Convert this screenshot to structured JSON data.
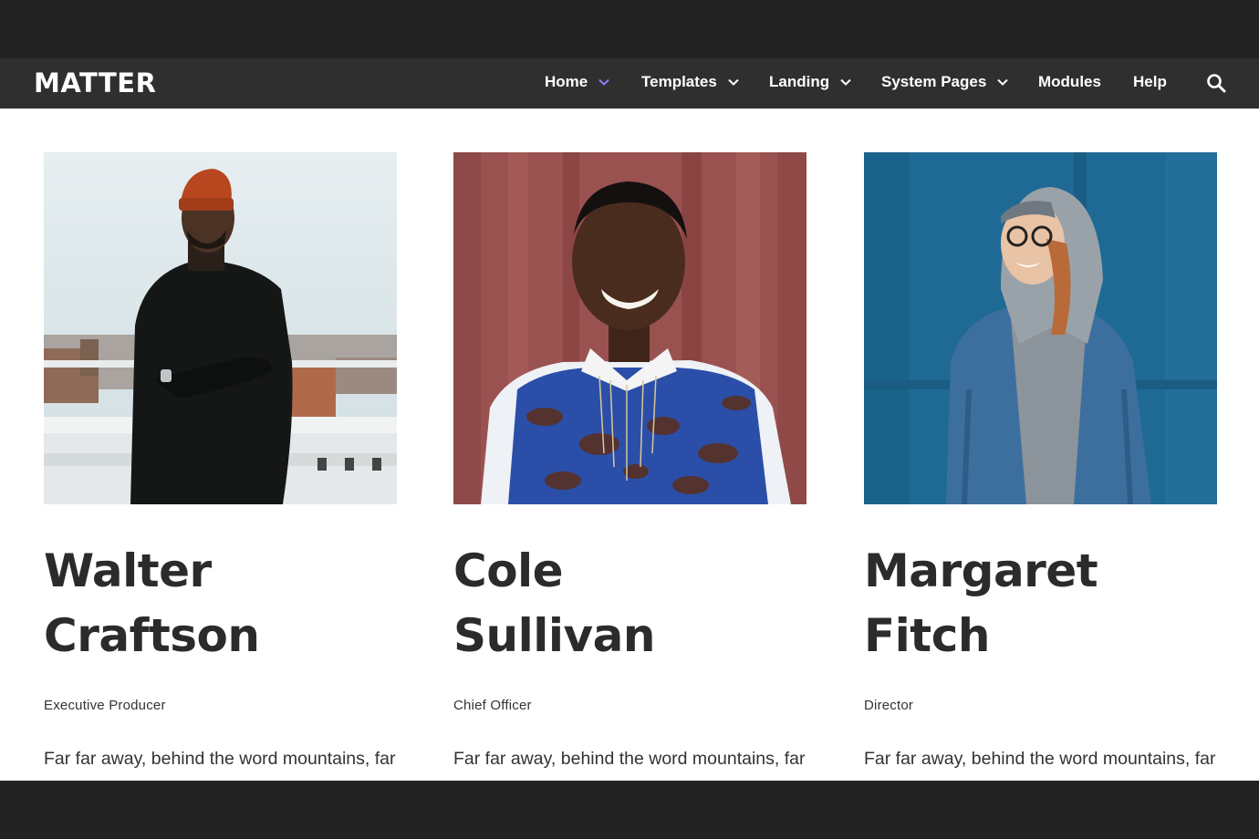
{
  "header": {
    "logo": "MATTER",
    "nav": [
      {
        "label": "Home",
        "has_dropdown": true
      },
      {
        "label": "Templates",
        "has_dropdown": true
      },
      {
        "label": "Landing",
        "has_dropdown": true
      },
      {
        "label": "System Pages",
        "has_dropdown": true
      },
      {
        "label": "Modules",
        "has_dropdown": false
      },
      {
        "label": "Help",
        "has_dropdown": false
      }
    ],
    "search_icon": "search-icon",
    "accent_color": "#8b7cf6"
  },
  "team": [
    {
      "first_name": "Walter",
      "last_name": "Craftson",
      "role": "Executive Producer",
      "bio": "Far far away, behind the word mountains, far from the countries Vokalia and"
    },
    {
      "first_name": "Cole",
      "last_name": "Sullivan",
      "role": "Chief Officer",
      "bio": "Far far away, behind the word mountains, far from the countries Vokalia and"
    },
    {
      "first_name": "Margaret",
      "last_name": "Fitch",
      "role": "Director",
      "bio": "Far far away, behind the word mountains, far from the countries Vokalia and"
    }
  ]
}
